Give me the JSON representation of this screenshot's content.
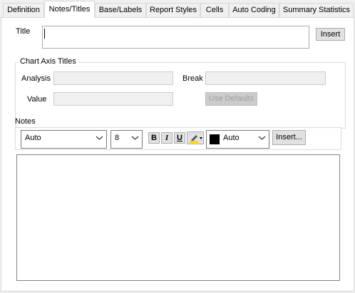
{
  "tabs": [
    {
      "label": "Definition",
      "active": false
    },
    {
      "label": "Notes/Titles",
      "active": true
    },
    {
      "label": "Base/Labels",
      "active": false
    },
    {
      "label": "Report Styles",
      "active": false
    },
    {
      "label": "Cells",
      "active": false
    },
    {
      "label": "Auto Coding",
      "active": false
    },
    {
      "label": "Summary Statistics",
      "active": false
    }
  ],
  "title": {
    "label": "Title",
    "value": "",
    "insert_label": "Insert"
  },
  "chart_axis": {
    "group_label": "Chart Axis Titles",
    "analysis_label": "Analysis",
    "analysis_value": "",
    "break_label": "Break",
    "break_value": "",
    "value_label": "Value",
    "value_value": "",
    "use_defaults_label": "Use Defaults"
  },
  "notes": {
    "label": "Notes",
    "font": "Auto",
    "size": "8",
    "bold_label": "B",
    "italic_label": "I",
    "underline_label": "U",
    "color_label": "Auto",
    "color_swatch": "#000000",
    "highlight_color": "#ffd700",
    "insert_label": "Insert...",
    "content": ""
  }
}
